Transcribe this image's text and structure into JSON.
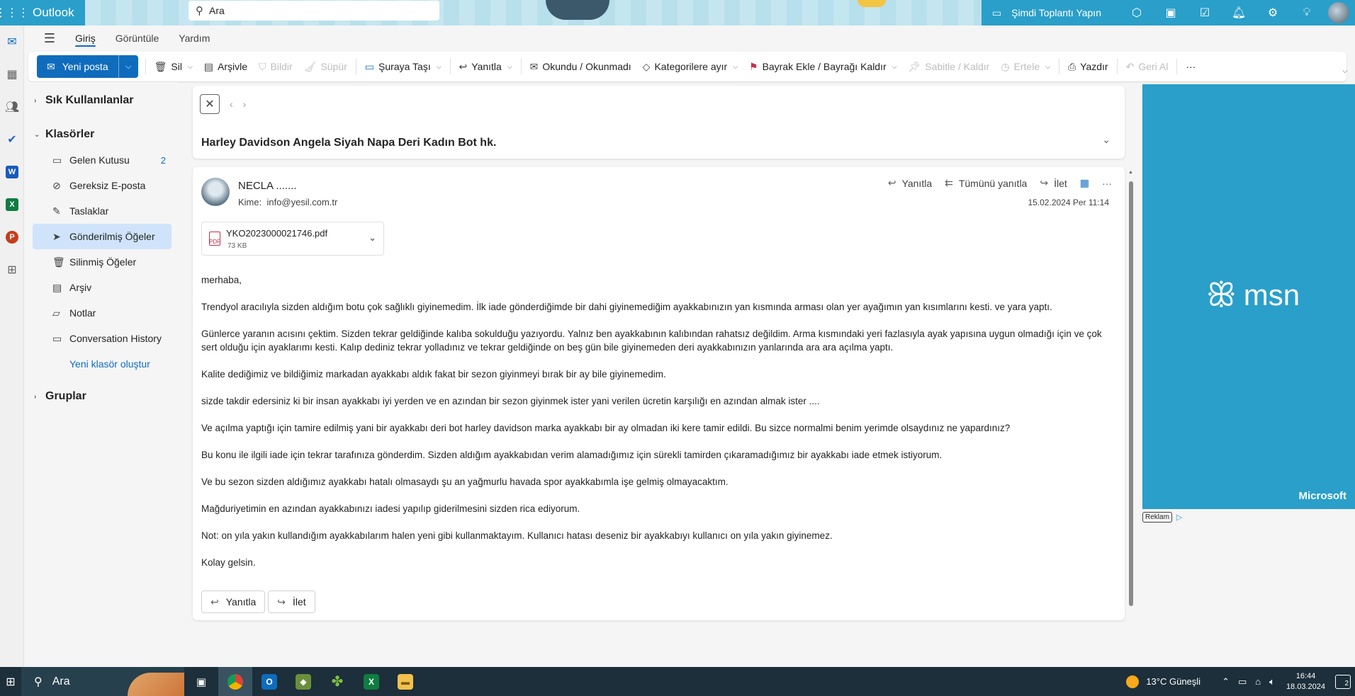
{
  "header": {
    "app_name": "Outlook",
    "search_placeholder": "Ara",
    "meet_now": "Şimdi Toplantı Yapın"
  },
  "tabs": [
    {
      "label": "Giriş",
      "active": true
    },
    {
      "label": "Görüntüle",
      "active": false
    },
    {
      "label": "Yardım",
      "active": false
    }
  ],
  "ribbon": {
    "new_mail": "Yeni posta",
    "delete": "Sil",
    "archive": "Arşivle",
    "report": "Bildir",
    "sweep": "Süpür",
    "move_to": "Şuraya Taşı",
    "reply": "Yanıtla",
    "read_unread": "Okundu / Okunmadı",
    "categorize": "Kategorilere ayır",
    "flag": "Bayrak Ekle / Bayrağı Kaldır",
    "pin": "Sabitle / Kaldır",
    "snooze": "Ertele",
    "print": "Yazdır",
    "undo": "Geri Al",
    "more": "···"
  },
  "folders": {
    "favorites": "Sık Kullanılanlar",
    "folders_title": "Klasörler",
    "items": [
      {
        "label": "Gelen Kutusu",
        "count": "2",
        "icon": "inbox-icon"
      },
      {
        "label": "Gereksiz E-posta",
        "count": "",
        "icon": "junk-icon"
      },
      {
        "label": "Taslaklar",
        "count": "",
        "icon": "drafts-icon"
      },
      {
        "label": "Gönderilmiş Öğeler",
        "count": "",
        "icon": "sent-icon",
        "selected": true
      },
      {
        "label": "Silinmiş Öğeler",
        "count": "",
        "icon": "trash-icon"
      },
      {
        "label": "Arşiv",
        "count": "",
        "icon": "archive-icon"
      },
      {
        "label": "Notlar",
        "count": "",
        "icon": "notes-icon"
      },
      {
        "label": "Conversation History",
        "count": "",
        "icon": "folder-icon"
      }
    ],
    "new_folder": "Yeni klasör oluştur",
    "groups": "Gruplar"
  },
  "message": {
    "subject": "Harley Davidson Angela Siyah Napa Deri Kadın Bot hk.",
    "sender": "NECLA .......",
    "to_label": "Kime:",
    "to": "info@yesil.com.tr",
    "date": "15.02.2024 Per 11:14",
    "reply": "Yanıtla",
    "reply_all": "Tümünü yanıtla",
    "forward": "İlet",
    "attachment": {
      "name": "YKO2023000021746.pdf",
      "size": "73 KB"
    },
    "body": [
      "merhaba,",
      "Trendyol aracılıyla sizden aldığım botu çok sağlıklı giyinemedim. İlk iade gönderdiğimde bir dahi giyinemediğim ayakkabınızın yan kısmında arması olan yer ayağımın yan kısımlarını kesti.  ve yara yaptı.",
      "Günlerce yaranın acısını çektim.  Sizden tekrar geldiğinde kalıba sokulduğu yazıyordu. Yalnız ben ayakkabının kalıbından rahatsız değildim. Arma kısmındaki yeri fazlasıyla ayak yapısına uygun olmadığı için ve çok sert olduğu için ayaklarımı kesti. Kalıp dediniz tekrar yolladınız ve tekrar geldiğinde on beş gün bile giyinemeden deri ayakkabınızın yanlarında ara ara açılma yaptı.",
      "Kalite dediğimiz ve bildiğimiz markadan ayakkabı aldık fakat bir sezon giyinmeyi bırak bir ay bile giyinemedim.",
      "sizde takdir edersiniz ki bir insan ayakkabı iyi yerden ve en azından bir sezon giyinmek ister yani verilen ücretin karşılığı en azından almak ister ....",
      "Ve açılma yaptığı için tamire edilmiş yani bir ayakkabı deri bot harley davidson marka ayakkabı bir ay olmadan iki kere tamir edildi. Bu sizce normalmi benim yerimde olsaydınız ne yapardınız?",
      "Bu konu ile ilgili iade için tekrar tarafınıza gönderdim. Sizden aldığım ayakkabıdan verim alamadığımız için sürekli tamirden çıkaramadığımız bir ayakkabı iade etmek istiyorum.",
      "Ve bu sezon sizden aldığımız ayakkabı hatalı olmasaydı şu an yağmurlu havada spor ayakkabımla işe gelmiş olmayacaktım.",
      "Mağduriyetimin en azından ayakkabınızı iadesi yapılıp giderilmesini sizden rica ediyorum.",
      "Not: on yıla yakın kullandığım ayakkabılarım halen yeni gibi kullanmaktayım. Kullanıcı hatası deseniz bir ayakkabıyı kullanıcı on yıla yakın giyinemez.",
      "Kolay gelsin."
    ]
  },
  "ad": {
    "brand": "msn",
    "company": "Microsoft",
    "label": "Reklam"
  },
  "taskbar": {
    "search": "Ara",
    "weather": "13°C  Güneşli",
    "time": "16:44",
    "date": "18.03.2024",
    "notifications": "2"
  },
  "colors": {
    "accent": "#0f6cbd",
    "header": "#2a9fc9",
    "selected_folder": "#cfe4fa"
  }
}
